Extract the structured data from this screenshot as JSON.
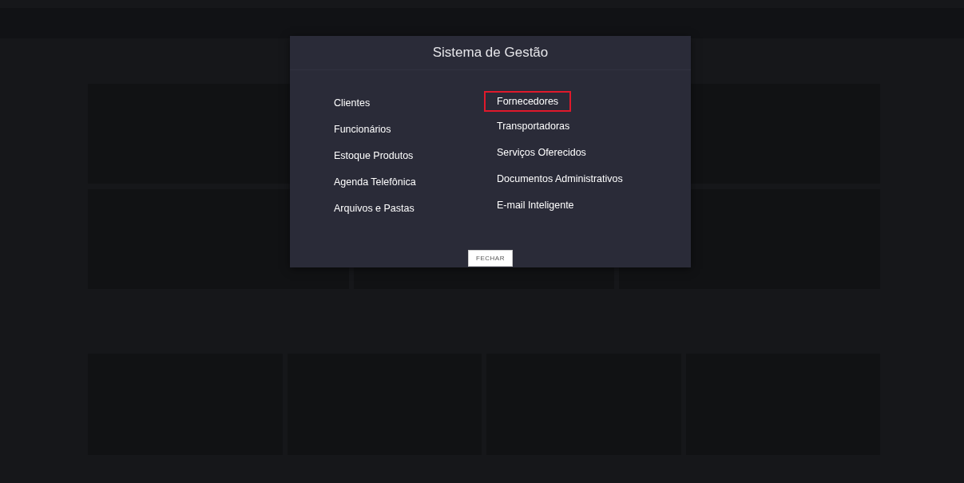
{
  "modal": {
    "title": "Sistema de Gestão",
    "columns": [
      [
        {
          "label": "Clientes",
          "selected": false
        },
        {
          "label": "Funcionários",
          "selected": false
        },
        {
          "label": "Estoque Produtos",
          "selected": false
        },
        {
          "label": "Agenda Telefônica",
          "selected": false
        },
        {
          "label": "Arquivos e Pastas",
          "selected": false
        }
      ],
      [
        {
          "label": "Fornecedores",
          "selected": true
        },
        {
          "label": "Transportadoras",
          "selected": false
        },
        {
          "label": "Serviços Oferecidos",
          "selected": false
        },
        {
          "label": "Documentos Administrativos",
          "selected": false
        },
        {
          "label": "E-mail Inteligente",
          "selected": false
        }
      ]
    ],
    "close_button": "FECHAR"
  }
}
